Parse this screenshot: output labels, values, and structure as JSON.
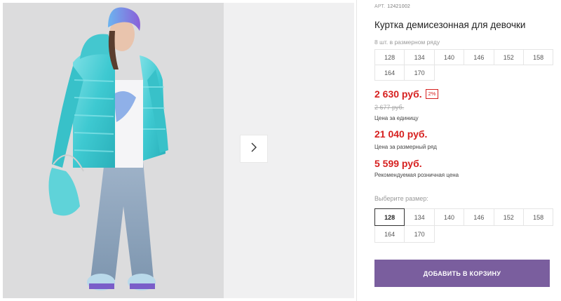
{
  "gallery": {
    "main_image": "photo-girl-in-turquoise-jacket",
    "next_icon": "chevron-right-icon"
  },
  "product": {
    "article_label": "АРТ.",
    "article_value": "12421002",
    "title": "Куртка демисезонная для девочки"
  },
  "size_set": {
    "caption": "8 шт. в размерном ряду",
    "sizes": [
      "128",
      "134",
      "140",
      "146",
      "152",
      "158",
      "164",
      "170"
    ]
  },
  "pricing": {
    "unit_price": "2 630 руб.",
    "discount": "2%",
    "old_price": "2 677 руб.",
    "unit_label": "Цена за единицу",
    "set_price": "21 040 руб.",
    "set_label": "Цена за размерный ряд",
    "rrp_price": "5 599 руб.",
    "rrp_label": "Рекомендуемая розничная цена",
    "accent_color": "#d6201f"
  },
  "size_picker": {
    "caption": "Выберите размер:",
    "selected": "128",
    "sizes": [
      "128",
      "134",
      "140",
      "146",
      "152",
      "158",
      "164",
      "170"
    ]
  },
  "cart": {
    "button_label": "ДОБАВИТЬ В КОРЗИНУ",
    "button_color": "#7a5e9e"
  }
}
